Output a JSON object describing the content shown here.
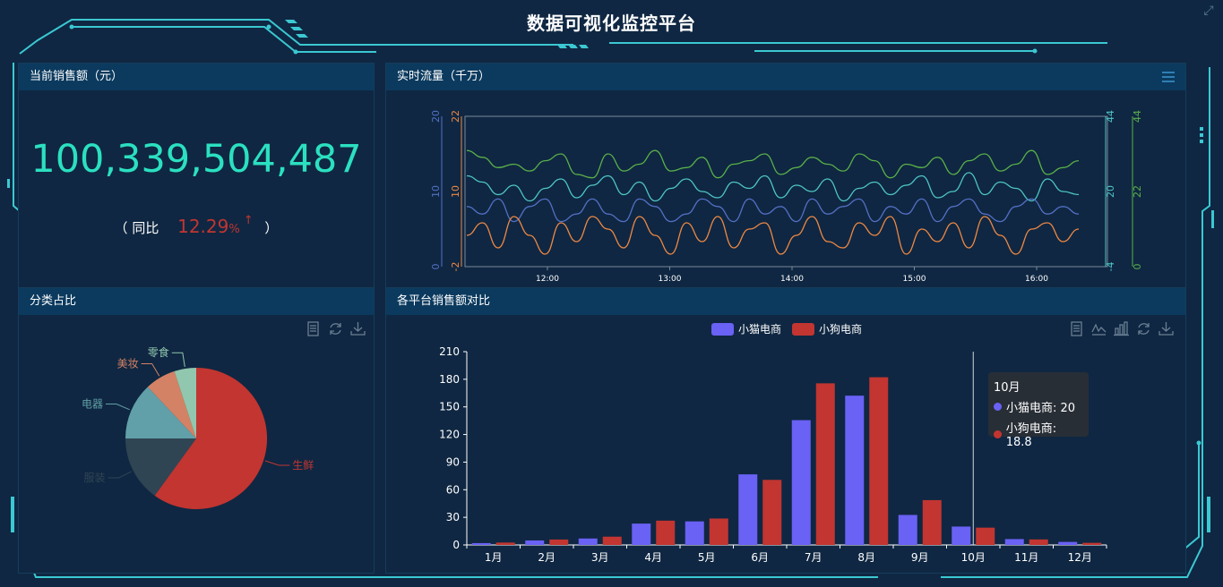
{
  "app": {
    "title": "数据可视化监控平台"
  },
  "sales_panel": {
    "title": "当前销售额（元）",
    "amount": "100,339,504,487",
    "yoy_open": "（  同比",
    "yoy_pct": "12.29",
    "yoy_unit": "%",
    "yoy_arrow": "↑",
    "yoy_close": "）"
  },
  "flow_panel": {
    "title": "实时流量（千万）",
    "menu_icon": "hamburger-menu-icon"
  },
  "category_panel": {
    "title": "分类占比",
    "tools": [
      "data-view-icon",
      "refresh-icon",
      "download-icon"
    ]
  },
  "platform_panel": {
    "title": "各平台销售额对比",
    "tools": [
      "data-view-icon",
      "line-chart-icon",
      "bar-chart-icon",
      "refresh-icon",
      "download-icon"
    ],
    "tooltip": {
      "month": "10月",
      "row1": "小猫电商: 20",
      "row2": "小狗电商: 18.8"
    }
  },
  "colors": {
    "accent": "#2be0c0",
    "frame": "#3bc8d2",
    "cat_series": "#6a61f5",
    "dog_series": "#c23531",
    "up": "#c23531"
  },
  "chart_data": [
    {
      "type": "line",
      "x_ticks": [
        "12:00",
        "13:00",
        "14:00",
        "15:00",
        "16:00"
      ],
      "axes": [
        {
          "side": "left-outer",
          "color": "#5470c6",
          "ticks": [
            "0",
            "10",
            "20"
          ],
          "range": [
            0,
            20
          ]
        },
        {
          "side": "left-inner",
          "color": "#ee8844",
          "ticks": [
            "-2",
            "10",
            "22"
          ],
          "range": [
            -2,
            22
          ]
        },
        {
          "side": "right-inner",
          "color": "#4fc5c5",
          "ticks": [
            "-4",
            "20",
            "44"
          ],
          "range": [
            -4,
            44
          ]
        },
        {
          "side": "right-outer",
          "color": "#5ab04a",
          "ticks": [
            "0",
            "22",
            "44"
          ],
          "range": [
            0,
            44
          ]
        }
      ],
      "series": [
        {
          "color": "#5ab04a",
          "axis": 3,
          "values": [
            34,
            32,
            29,
            30,
            28,
            31,
            33,
            27,
            26,
            33,
            28,
            30,
            34,
            28,
            29,
            32,
            26,
            30,
            31,
            33,
            27,
            29,
            32,
            30,
            28,
            33,
            31,
            26,
            30,
            29,
            32,
            27,
            31,
            33,
            28,
            30,
            34,
            27,
            29,
            31
          ]
        },
        {
          "color": "#4fc5c5",
          "axis": 2,
          "values": [
            25,
            23,
            19,
            22,
            17,
            21,
            24,
            18,
            22,
            25,
            19,
            23,
            17,
            21,
            24,
            20,
            18,
            23,
            21,
            25,
            18,
            22,
            20,
            24,
            17,
            21,
            23,
            19,
            22,
            25,
            18,
            20,
            26,
            19,
            23,
            21,
            17,
            24,
            20,
            19
          ]
        },
        {
          "color": "#5470c6",
          "axis": 0,
          "values": [
            8,
            7,
            9,
            6,
            8,
            9,
            6,
            7,
            9,
            7,
            6,
            9,
            8,
            6,
            7,
            9,
            8,
            6,
            9,
            7,
            8,
            6,
            9,
            7,
            8,
            9,
            6,
            8,
            7,
            9,
            6,
            8,
            9,
            7,
            6,
            8,
            9,
            7,
            8,
            7
          ]
        },
        {
          "color": "#ee8844",
          "axis": 1,
          "values": [
            3,
            5,
            1,
            6,
            3,
            0,
            5,
            2,
            6,
            4,
            1,
            6,
            3,
            0,
            5,
            2,
            6,
            1,
            4,
            5,
            0,
            3,
            6,
            2,
            1,
            5,
            3,
            6,
            0,
            4,
            2,
            5,
            1,
            6,
            3,
            0,
            4,
            5,
            2,
            4
          ]
        }
      ]
    },
    {
      "type": "pie",
      "slices": [
        {
          "name": "生鲜",
          "value": 60,
          "color": "#c23531"
        },
        {
          "name": "服装",
          "value": 15,
          "color": "#2f4554"
        },
        {
          "name": "电器",
          "value": 13,
          "color": "#61a0a8"
        },
        {
          "name": "美妆",
          "value": 7,
          "color": "#d48265"
        },
        {
          "name": "零食",
          "value": 5,
          "color": "#91c7ae"
        }
      ]
    },
    {
      "type": "bar",
      "categories": [
        "1月",
        "2月",
        "3月",
        "4月",
        "5月",
        "6月",
        "7月",
        "8月",
        "9月",
        "10月",
        "11月",
        "12月"
      ],
      "ylim": [
        0,
        210
      ],
      "y_ticks": [
        0,
        30,
        60,
        90,
        120,
        150,
        180,
        210
      ],
      "series": [
        {
          "name": "小猫电商",
          "color": "#6a61f5",
          "values": [
            2.0,
            4.9,
            7.0,
            23.2,
            25.6,
            76.7,
            135.6,
            162.2,
            32.6,
            20.0,
            6.4,
            3.3
          ]
        },
        {
          "name": "小狗电商",
          "color": "#c23531",
          "values": [
            2.6,
            5.9,
            9.0,
            26.4,
            28.7,
            70.7,
            175.6,
            182.2,
            48.7,
            18.8,
            6.0,
            2.3
          ]
        }
      ]
    }
  ]
}
